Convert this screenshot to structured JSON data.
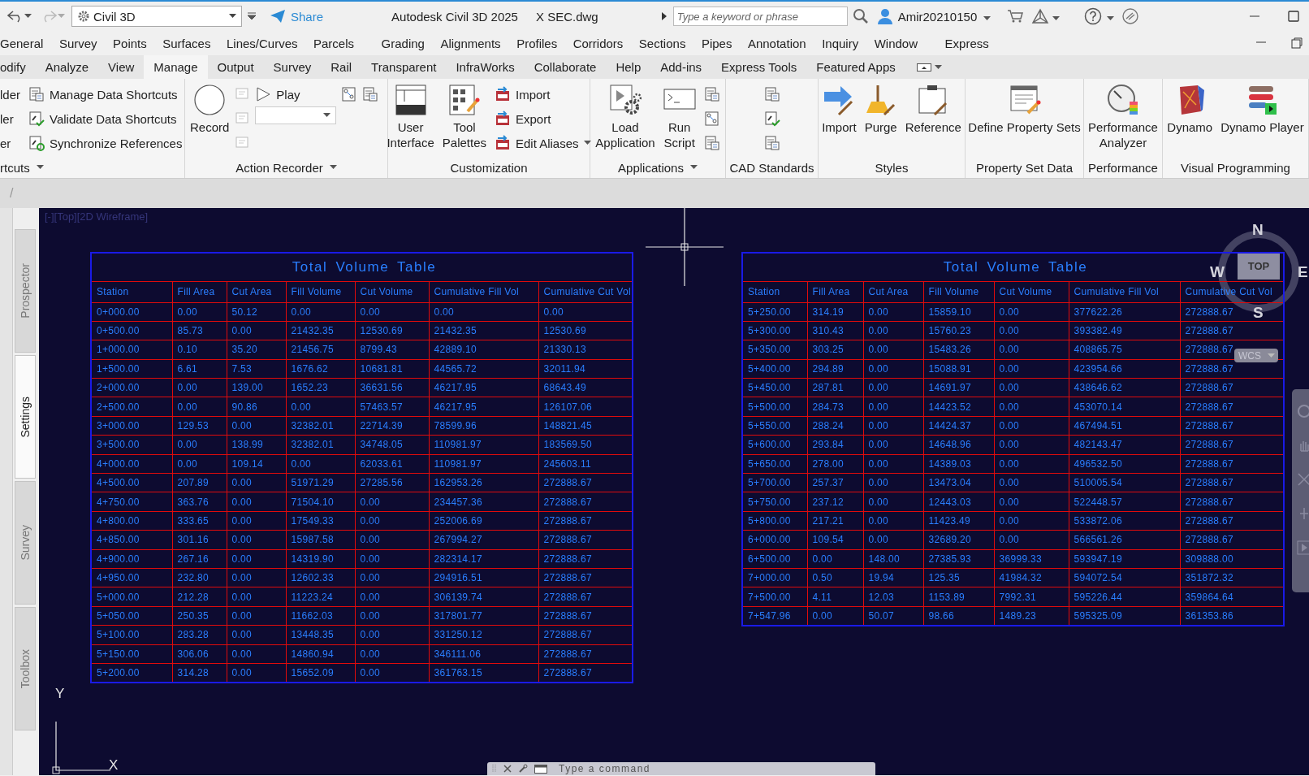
{
  "title_bar": {
    "workspace": "Civil 3D",
    "share": "Share",
    "app_title": "Autodesk Civil 3D 2025",
    "file_name": "X SEC.dwg",
    "search": {
      "placeholder": "Type a keyword or phrase"
    },
    "user": "Amir20210150"
  },
  "menu_bar": [
    "General",
    "Survey",
    "Points",
    "Surfaces",
    "Lines/Curves",
    "Parcels",
    "Grading",
    "Alignments",
    "Profiles",
    "Corridors",
    "Sections",
    "Pipes",
    "Annotation",
    "Inquiry",
    "Window",
    "Express"
  ],
  "ribbon_tabs": [
    {
      "label": "odify",
      "selected": false
    },
    {
      "label": "Analyze",
      "selected": false
    },
    {
      "label": "View",
      "selected": false
    },
    {
      "label": "Manage",
      "selected": true
    },
    {
      "label": "Output",
      "selected": false
    },
    {
      "label": "Survey",
      "selected": false
    },
    {
      "label": "Rail",
      "selected": false
    },
    {
      "label": "Transparent",
      "selected": false
    },
    {
      "label": "InfraWorks",
      "selected": false
    },
    {
      "label": "Collaborate",
      "selected": false
    },
    {
      "label": "Help",
      "selected": false
    },
    {
      "label": "Add-ins",
      "selected": false
    },
    {
      "label": "Express Tools",
      "selected": false
    },
    {
      "label": "Featured Apps",
      "selected": false
    }
  ],
  "ribbon_panels": [
    {
      "title": "rtcuts",
      "dropdown": true,
      "columns": [
        [
          {
            "kind": "text",
            "label": "lder"
          },
          {
            "kind": "text",
            "label": "ler"
          },
          {
            "kind": "text",
            "label": "er"
          }
        ],
        [
          {
            "kind": "small",
            "label": "Manage Data Shortcuts"
          },
          {
            "kind": "small",
            "label": "Validate Data Shortcuts"
          },
          {
            "kind": "small",
            "label": "Synchronize References"
          }
        ]
      ]
    },
    {
      "title": "Action Recorder",
      "dropdown": true,
      "columns": [
        [
          {
            "kind": "large",
            "label": "Record"
          }
        ],
        [
          {
            "kind": "icon"
          },
          {
            "kind": "icon"
          },
          {
            "kind": "icon"
          }
        ],
        [
          {
            "kind": "small",
            "label": "Play"
          },
          {
            "kind": "combo"
          }
        ],
        [
          {
            "kind": "icon"
          }
        ],
        [
          {
            "kind": "icon"
          }
        ]
      ]
    },
    {
      "title": "Customization",
      "dropdown": false,
      "columns": [
        [
          {
            "kind": "large",
            "label": "User\nInterface"
          }
        ],
        [
          {
            "kind": "large",
            "label": "Tool\nPalettes"
          }
        ],
        [
          {
            "kind": "small",
            "label": "Import"
          },
          {
            "kind": "small",
            "label": "Export"
          },
          {
            "kind": "small",
            "label": "Edit Aliases",
            "dropdown": true
          }
        ]
      ]
    },
    {
      "title": "Applications",
      "dropdown": true,
      "columns": [
        [
          {
            "kind": "large",
            "label": "Load\nApplication"
          }
        ],
        [
          {
            "kind": "large",
            "label": "Run\nScript"
          }
        ],
        [
          {
            "kind": "icon"
          },
          {
            "kind": "icon"
          },
          {
            "kind": "icon"
          }
        ]
      ]
    },
    {
      "title": "CAD Standards",
      "dropdown": false,
      "columns": [
        [
          {
            "kind": "icon"
          },
          {
            "kind": "icon"
          },
          {
            "kind": "icon"
          }
        ]
      ]
    },
    {
      "title": "Styles",
      "dropdown": false,
      "columns": [
        [
          {
            "kind": "large",
            "label": "Import"
          }
        ],
        [
          {
            "kind": "large",
            "label": "Purge"
          }
        ],
        [
          {
            "kind": "large",
            "label": "Reference"
          }
        ]
      ]
    },
    {
      "title": "Property Set Data",
      "dropdown": false,
      "columns": [
        [
          {
            "kind": "large",
            "label": "Define Property Sets"
          }
        ]
      ]
    },
    {
      "title": "Performance",
      "dropdown": false,
      "columns": [
        [
          {
            "kind": "large",
            "label": "Performance\nAnalyzer"
          }
        ]
      ]
    },
    {
      "title": "Visual Programming",
      "dropdown": false,
      "columns": [
        [
          {
            "kind": "large",
            "label": "Dynamo"
          }
        ],
        [
          {
            "kind": "large",
            "label": "Dynamo Player"
          }
        ]
      ]
    }
  ],
  "file_tab_bar": {
    "separator": "/"
  },
  "drawing": {
    "viewport_label": "[-][Top][2D Wireframe]",
    "palette_tabs": [
      {
        "label": "Prospector",
        "selected": false
      },
      {
        "label": "Settings",
        "selected": true
      },
      {
        "label": "Survey",
        "selected": false
      },
      {
        "label": "Toolbox",
        "selected": false
      }
    ],
    "tables": [
      {
        "title": "Total Volume Table",
        "columns": [
          "Station",
          "Fill Area",
          "Cut Area",
          "Fill Volume",
          "Cut Volume",
          "Cumulative Fill Vol",
          "Cumulative Cut Vol"
        ],
        "rows": [
          [
            "0+000.00",
            "0.00",
            "50.12",
            "0.00",
            "0.00",
            "0.00",
            "0.00"
          ],
          [
            "0+500.00",
            "85.73",
            "0.00",
            "21432.35",
            "12530.69",
            "21432.35",
            "12530.69"
          ],
          [
            "1+000.00",
            "0.10",
            "35.20",
            "21456.75",
            "8799.43",
            "42889.10",
            "21330.13"
          ],
          [
            "1+500.00",
            "6.61",
            "7.53",
            "1676.62",
            "10681.81",
            "44565.72",
            "32011.94"
          ],
          [
            "2+000.00",
            "0.00",
            "139.00",
            "1652.23",
            "36631.56",
            "46217.95",
            "68643.49"
          ],
          [
            "2+500.00",
            "0.00",
            "90.86",
            "0.00",
            "57463.57",
            "46217.95",
            "126107.06"
          ],
          [
            "3+000.00",
            "129.53",
            "0.00",
            "32382.01",
            "22714.39",
            "78599.96",
            "148821.45"
          ],
          [
            "3+500.00",
            "0.00",
            "138.99",
            "32382.01",
            "34748.05",
            "110981.97",
            "183569.50"
          ],
          [
            "4+000.00",
            "0.00",
            "109.14",
            "0.00",
            "62033.61",
            "110981.97",
            "245603.11"
          ],
          [
            "4+500.00",
            "207.89",
            "0.00",
            "51971.29",
            "27285.56",
            "162953.26",
            "272888.67"
          ],
          [
            "4+750.00",
            "363.76",
            "0.00",
            "71504.10",
            "0.00",
            "234457.36",
            "272888.67"
          ],
          [
            "4+800.00",
            "333.65",
            "0.00",
            "17549.33",
            "0.00",
            "252006.69",
            "272888.67"
          ],
          [
            "4+850.00",
            "301.16",
            "0.00",
            "15987.58",
            "0.00",
            "267994.27",
            "272888.67"
          ],
          [
            "4+900.00",
            "267.16",
            "0.00",
            "14319.90",
            "0.00",
            "282314.17",
            "272888.67"
          ],
          [
            "4+950.00",
            "232.80",
            "0.00",
            "12602.33",
            "0.00",
            "294916.51",
            "272888.67"
          ],
          [
            "5+000.00",
            "212.28",
            "0.00",
            "11223.24",
            "0.00",
            "306139.74",
            "272888.67"
          ],
          [
            "5+050.00",
            "250.35",
            "0.00",
            "11662.03",
            "0.00",
            "317801.77",
            "272888.67"
          ],
          [
            "5+100.00",
            "283.28",
            "0.00",
            "13448.35",
            "0.00",
            "331250.12",
            "272888.67"
          ],
          [
            "5+150.00",
            "306.06",
            "0.00",
            "14860.94",
            "0.00",
            "346111.06",
            "272888.67"
          ],
          [
            "5+200.00",
            "314.28",
            "0.00",
            "15652.09",
            "0.00",
            "361763.15",
            "272888.67"
          ]
        ]
      },
      {
        "title": "Total Volume Table",
        "columns": [
          "Station",
          "Fill Area",
          "Cut Area",
          "Fill Volume",
          "Cut Volume",
          "Cumulative Fill Vol",
          "Cumulative Cut Vol"
        ],
        "rows": [
          [
            "5+250.00",
            "314.19",
            "0.00",
            "15859.10",
            "0.00",
            "377622.26",
            "272888.67"
          ],
          [
            "5+300.00",
            "310.43",
            "0.00",
            "15760.23",
            "0.00",
            "393382.49",
            "272888.67"
          ],
          [
            "5+350.00",
            "303.25",
            "0.00",
            "15483.26",
            "0.00",
            "408865.75",
            "272888.67"
          ],
          [
            "5+400.00",
            "294.89",
            "0.00",
            "15088.91",
            "0.00",
            "423954.66",
            "272888.67"
          ],
          [
            "5+450.00",
            "287.81",
            "0.00",
            "14691.97",
            "0.00",
            "438646.62",
            "272888.67"
          ],
          [
            "5+500.00",
            "284.73",
            "0.00",
            "14423.52",
            "0.00",
            "453070.14",
            "272888.67"
          ],
          [
            "5+550.00",
            "288.24",
            "0.00",
            "14424.37",
            "0.00",
            "467494.51",
            "272888.67"
          ],
          [
            "5+600.00",
            "293.84",
            "0.00",
            "14648.96",
            "0.00",
            "482143.47",
            "272888.67"
          ],
          [
            "5+650.00",
            "278.00",
            "0.00",
            "14389.03",
            "0.00",
            "496532.50",
            "272888.67"
          ],
          [
            "5+700.00",
            "257.37",
            "0.00",
            "13473.04",
            "0.00",
            "510005.54",
            "272888.67"
          ],
          [
            "5+750.00",
            "237.12",
            "0.00",
            "12443.03",
            "0.00",
            "522448.57",
            "272888.67"
          ],
          [
            "5+800.00",
            "217.21",
            "0.00",
            "11423.49",
            "0.00",
            "533872.06",
            "272888.67"
          ],
          [
            "6+000.00",
            "109.54",
            "0.00",
            "32689.20",
            "0.00",
            "566561.26",
            "272888.67"
          ],
          [
            "6+500.00",
            "0.00",
            "148.00",
            "27385.93",
            "36999.33",
            "593947.19",
            "309888.00"
          ],
          [
            "7+000.00",
            "0.50",
            "19.94",
            "125.35",
            "41984.32",
            "594072.54",
            "351872.32"
          ],
          [
            "7+500.00",
            "4.11",
            "12.03",
            "1153.89",
            "7992.31",
            "595226.44",
            "359864.64"
          ],
          [
            "7+547.96",
            "0.00",
            "50.07",
            "98.66",
            "1489.23",
            "595325.09",
            "361353.86"
          ]
        ]
      }
    ],
    "view_cube": {
      "north": "N",
      "south": "S",
      "east": "E",
      "west": "W",
      "top": "TOP",
      "ucs": "WCS"
    },
    "ucs_icon": {
      "x": "X",
      "y": "Y"
    },
    "command_line": {
      "placeholder": "Type a command"
    }
  }
}
